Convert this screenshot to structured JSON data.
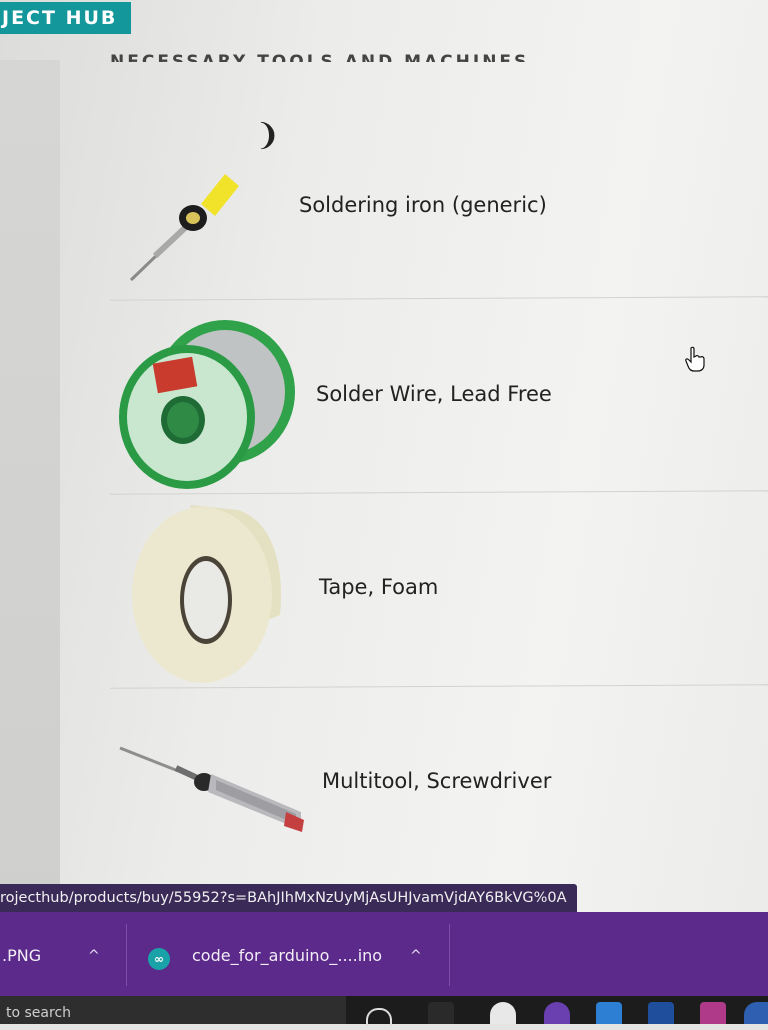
{
  "header": {
    "logo_text": "JECT HUB",
    "section_title": "NECESSARY TOOLS AND MACHINES",
    "stray_glyph": "❩"
  },
  "items": [
    {
      "label": "Soldering iron (generic)",
      "icon": "soldering-iron-icon"
    },
    {
      "label": "Solder Wire, Lead Free",
      "icon": "solder-wire-spool-icon"
    },
    {
      "label": "Tape, Foam",
      "icon": "tape-roll-icon"
    },
    {
      "label": "Multitool, Screwdriver",
      "icon": "screwdriver-icon"
    }
  ],
  "status_url": "rojecthub/products/buy/55952?s=BAhJIhMxNzUyMjAsUHJvamVjdAY6BkVG%0A",
  "downloads": [
    {
      "name": ".PNG",
      "chevron": "^"
    },
    {
      "name": "code_for_arduino_....ino",
      "chevron": "^",
      "icon_glyph": "∞"
    }
  ],
  "taskbar": {
    "search_text": "to search"
  },
  "colors": {
    "accent": "#14979a",
    "download_bar": "#5c2a8a",
    "url_tooltip": "#3a2a58",
    "taskbar": "#1c1c1c"
  }
}
